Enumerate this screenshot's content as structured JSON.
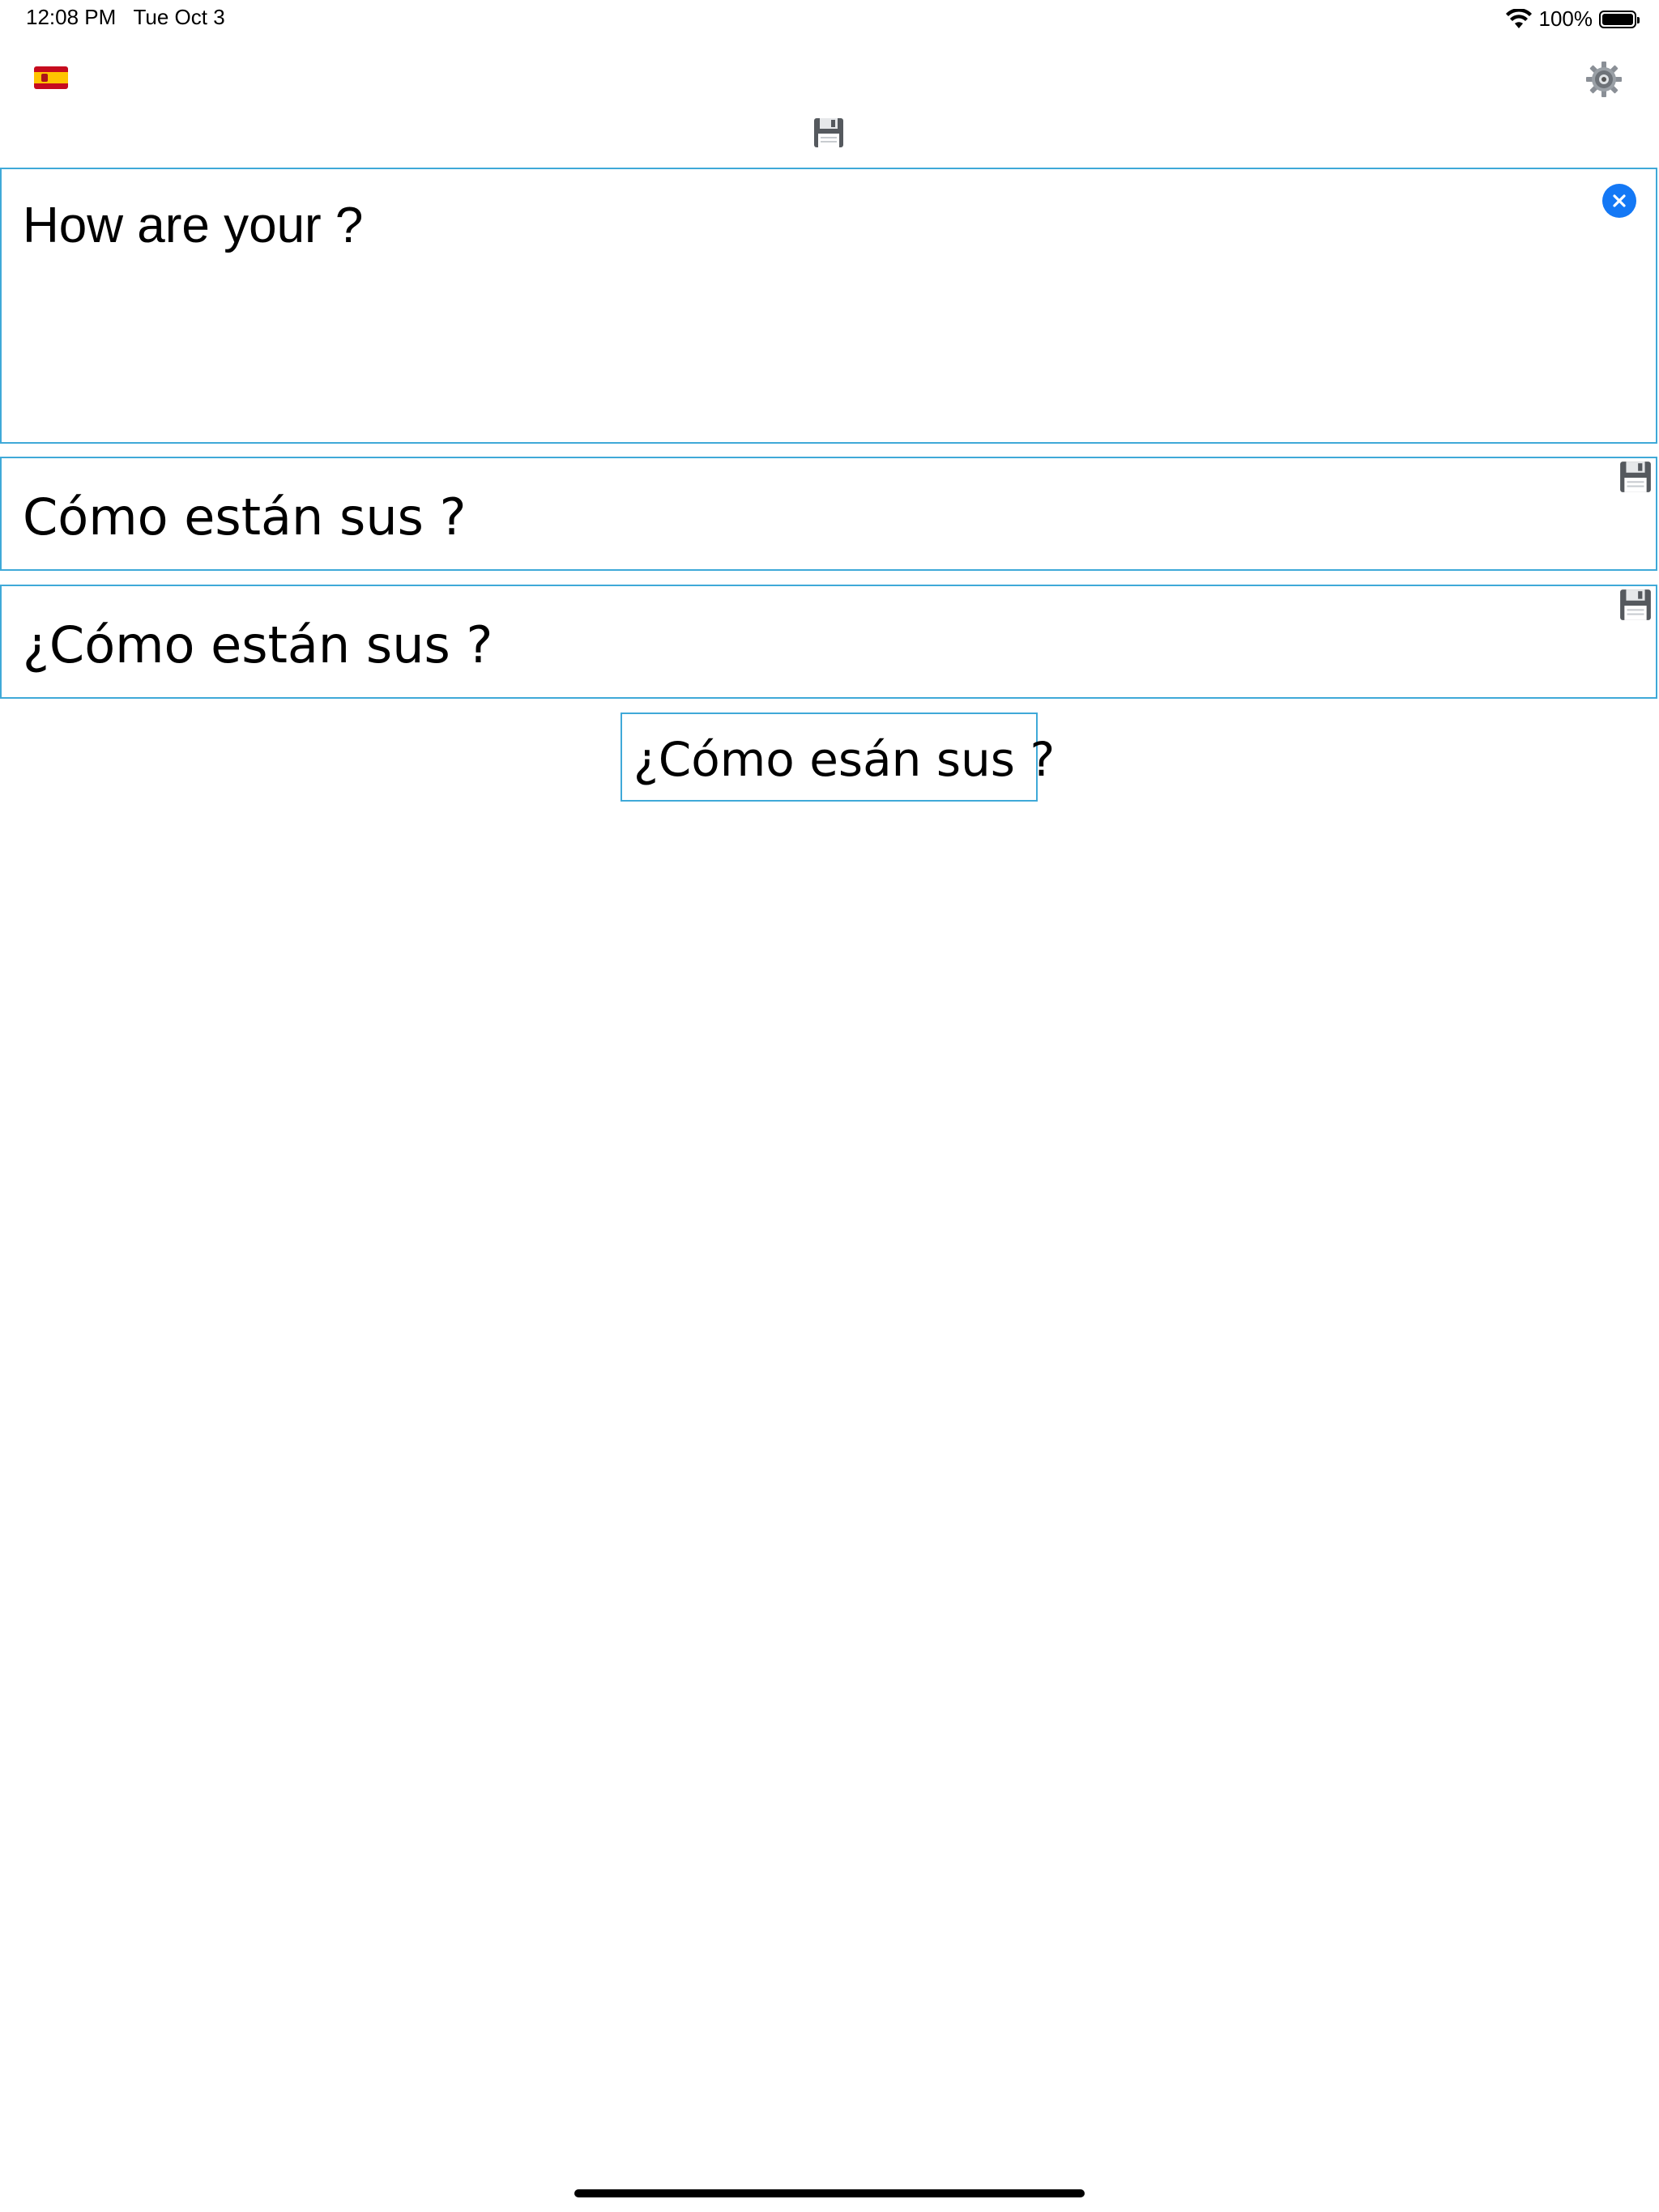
{
  "status_bar": {
    "time": "12:08 PM   Tue Oct 3",
    "battery": "100%"
  },
  "toolbar": {
    "language_flag": "spain-flag-icon",
    "settings": "gear-icon",
    "save": "save-icon"
  },
  "input": {
    "text": "How are your ?",
    "clear": "clear-icon"
  },
  "results": [
    {
      "text": "Cómo están sus ?",
      "save": "save-icon"
    },
    {
      "text": "¿Cómo están sus ?",
      "save": "save-icon"
    }
  ],
  "suggestion": {
    "text": "¿Cómo esán sus ?"
  },
  "colors": {
    "border": "#3fa9d8",
    "clear_button": "#1478f5"
  }
}
